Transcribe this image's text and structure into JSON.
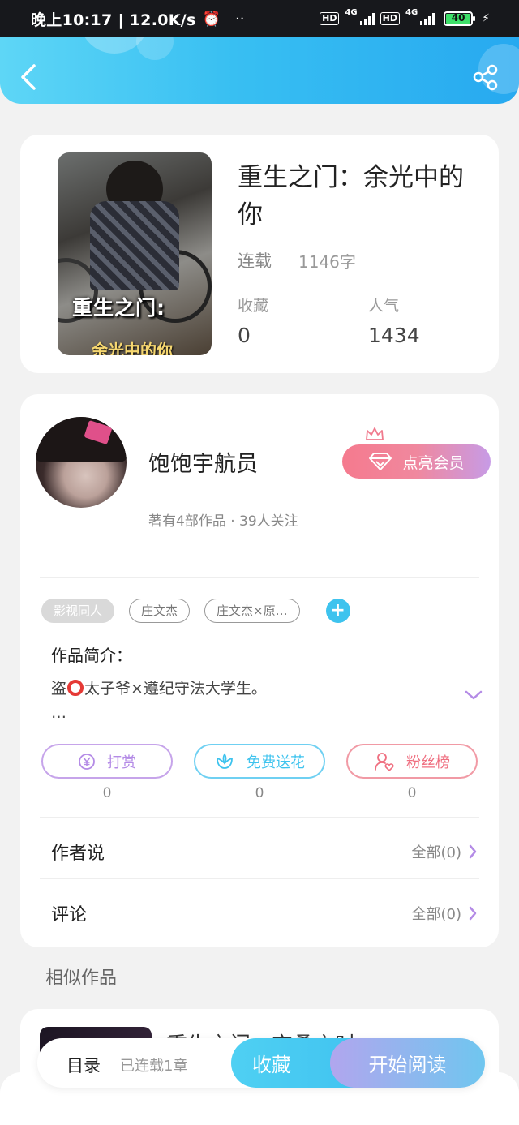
{
  "status_bar": {
    "time": "晚上10:17 | 12.0K/s",
    "alarm_icon": "alarm-clock-icon",
    "more": "··",
    "hd1": "HD",
    "net1": "4G",
    "hd2": "HD",
    "net2": "4G",
    "battery": "40"
  },
  "nav": {
    "back_icon": "chevron-left-icon",
    "share_icon": "share-icon"
  },
  "book": {
    "title": "重生之门：余光中的你",
    "cover_title": "重生之门:",
    "cover_subtitle": "余光中的你",
    "status": "连载",
    "word_count": "1146字",
    "fav_label": "收藏",
    "fav_value": "0",
    "pop_label": "人气",
    "pop_value": "1434"
  },
  "author": {
    "name": "饱饱宇航员",
    "subline": "著有4部作品 · 39人关注",
    "vip_label": "点亮会员",
    "tags": [
      "影视同人",
      "庄文杰",
      "庄文杰×原…"
    ],
    "add_tag": "+"
  },
  "intro": {
    "title": "作品简介：",
    "text_before": "盗",
    "text_after": "太子爷×遵纪守法大学生。",
    "ellipsis": "…"
  },
  "actions": [
    {
      "label": "打赏",
      "count": "0",
      "icon": "yen-icon",
      "color": "#b48be6"
    },
    {
      "label": "免费送花",
      "count": "0",
      "icon": "flower-icon",
      "color": "#3ec3ee"
    },
    {
      "label": "粉丝榜",
      "count": "0",
      "icon": "user-heart-icon",
      "color": "#ef6f80"
    }
  ],
  "rows": {
    "author_says": "作者说",
    "author_says_right": "全部(0)",
    "comments": "评论",
    "comments_right": "全部(0)"
  },
  "similar": {
    "title": "相似作品",
    "item_name": "重生之门：交叠之时"
  },
  "bottom_bar": {
    "toc": "目录",
    "chapters": "已连载1章",
    "fav": "收藏",
    "read": "开始阅读"
  }
}
